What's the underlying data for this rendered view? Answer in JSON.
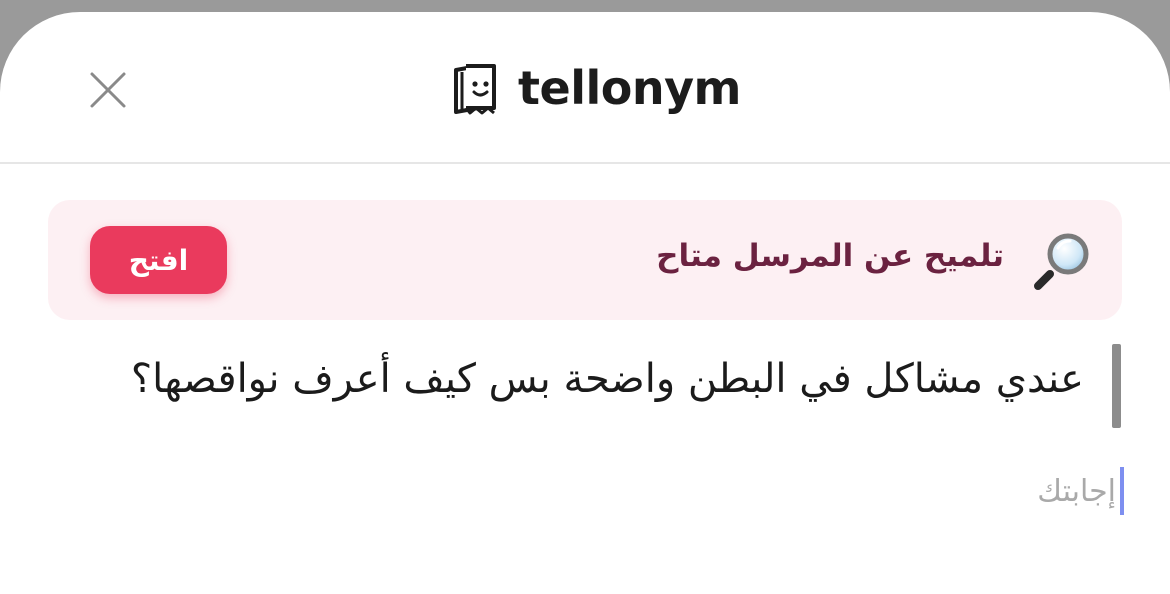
{
  "header": {
    "logo_text": "tellonym",
    "close_icon": "close-icon",
    "logo_icon": "tellonym-logo-icon"
  },
  "hint": {
    "text": "تلميح عن المرسل متاح",
    "button_label": "افتح",
    "icon": "magnifying-glass-icon"
  },
  "question": {
    "text": "عندي مشاكل في البطن واضحة بس كيف أعرف نواقصها؟"
  },
  "answer": {
    "placeholder": "إجابتك",
    "value": ""
  },
  "colors": {
    "accent": "#ea3a5d",
    "banner_bg": "#fdf0f3",
    "hint_text": "#6b2240",
    "caret": "#7e8ff0"
  }
}
